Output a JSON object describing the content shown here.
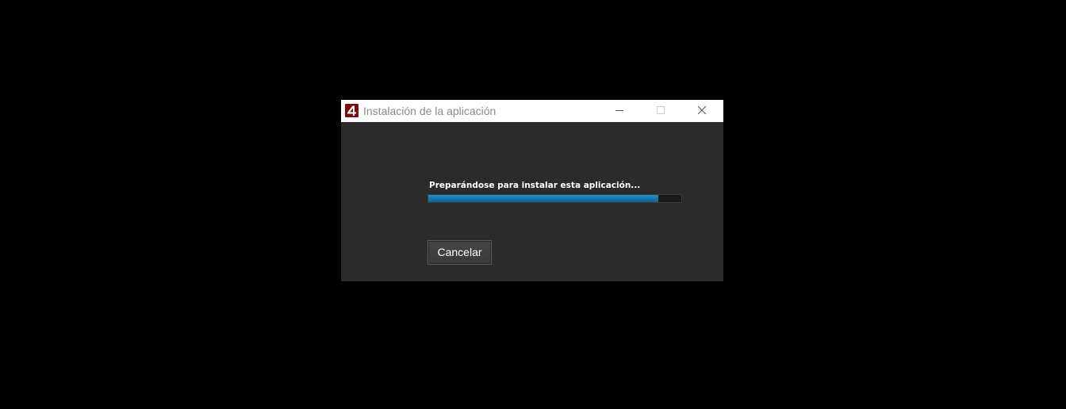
{
  "window": {
    "title": "Instalación de la aplicación",
    "icon": "adobe-air-icon",
    "controls": {
      "minimize": "minimize-icon",
      "maximize": "maximize-icon",
      "close": "close-icon"
    }
  },
  "installer": {
    "status": "Preparándose para instalar esta aplicación...",
    "progress_fraction": 0.91,
    "cancel_label": "Cancelar"
  },
  "colors": {
    "desktop": "#000000",
    "window_bg": "#2b2b2b",
    "titlebar_bg": "#ffffff",
    "progress_fill": "#1578b0",
    "app_icon": "#7a0d0d"
  }
}
